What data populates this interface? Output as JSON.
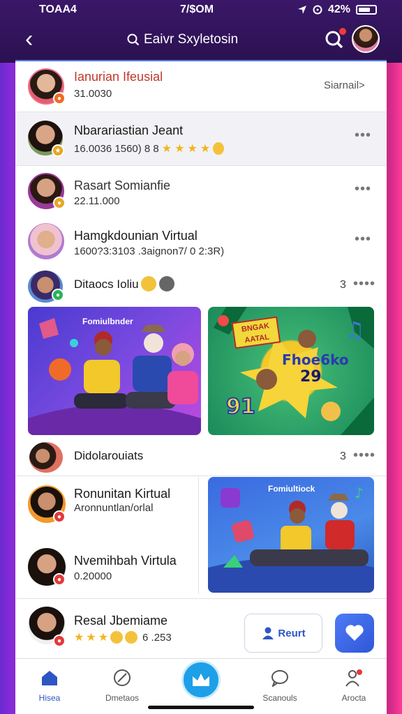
{
  "status": {
    "left": "TOAA4",
    "time": "7/$OM",
    "battery": "42%"
  },
  "header": {
    "title": "Eaivr Sxyletosin"
  },
  "rows": [
    {
      "name": "Ianurian Ifeusial",
      "sub": "31.0030",
      "action": "Siarnail>"
    },
    {
      "name": "Nbarariastian Jeant",
      "sub": "16.0036 1560) 8 8",
      "more": "•••"
    },
    {
      "name": "Rasart Somianfie",
      "sub": "22.11.000",
      "more": "•••"
    },
    {
      "name": "Hamgkdounian Virtual",
      "sub": "1600?3:3103 .3aignon7/ 0 2:3R)",
      "more": "•••"
    },
    {
      "name": "Ditaocs Ioliu",
      "count": "3",
      "more": "••••"
    }
  ],
  "cards": {
    "left_title": "Fomiulbnder",
    "right_badge": "BNGAK AATAL",
    "right_title": "Fhoe6ko",
    "right_number": "29",
    "right_number2": "91",
    "bottom_title": "Fomiultiock"
  },
  "group2": {
    "name": "Didolarouiats",
    "count": "3",
    "more": "••••"
  },
  "rows2": [
    {
      "name": "Ronunitan Kirtual",
      "sub": "Aronnuntlan/orlal"
    },
    {
      "name": "Nvemihbah Virtula",
      "sub": "0.20000"
    },
    {
      "name": "Resal Jbemiame",
      "sub": "6 .253"
    }
  ],
  "buttons": {
    "rsvp": "Reurt"
  },
  "tabs": [
    {
      "label": "Hisea"
    },
    {
      "label": "Dmetaos"
    },
    {
      "label": "Scanouls"
    },
    {
      "label": "Arocta"
    }
  ],
  "colors": {
    "accent": "#2d56c4",
    "fab": "#1da0e8",
    "title_red": "#c0392b"
  }
}
